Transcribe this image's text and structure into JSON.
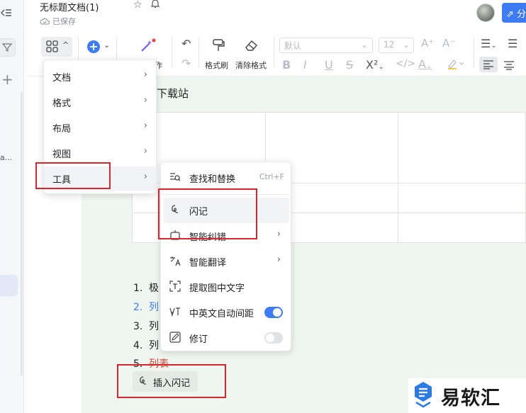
{
  "window": {
    "doc_title": "无标题文档(1)",
    "save_status": "已保存"
  },
  "header": {
    "share_label": "分"
  },
  "toolbar": {
    "format_painter": "格式刷",
    "clear_format": "清除格式",
    "font_name": "默认",
    "font_size": "12",
    "ai_partial_label": "作"
  },
  "menu_main": {
    "items": [
      {
        "label": "文档"
      },
      {
        "label": "格式"
      },
      {
        "label": "布局"
      },
      {
        "label": "视图"
      },
      {
        "label": "工具"
      }
    ]
  },
  "menu_tools": {
    "items": [
      {
        "label": "查找和替换",
        "hint": "Ctrl+F"
      },
      {
        "label": "闪记"
      },
      {
        "label": "智能纠错"
      },
      {
        "label": "智能翻译"
      },
      {
        "label": "提取图中文字"
      },
      {
        "label": "中英文自动间距",
        "toggle": true
      },
      {
        "label": "修订",
        "toggle": false
      }
    ]
  },
  "document": {
    "heading_partial": "下载站",
    "list": [
      {
        "num": "1.",
        "text": "极",
        "color": "#222222"
      },
      {
        "num": "2.",
        "text": "列",
        "color": "#3e7cf6"
      },
      {
        "num": "3.",
        "text": "列",
        "color": "#222222"
      },
      {
        "num": "4.",
        "text": "列",
        "color": "#222222"
      },
      {
        "num": "5.",
        "text": "列表",
        "color": "#e0463a"
      }
    ],
    "insert_button": "插入闪记"
  },
  "sidebar": {
    "truncated": "a..."
  },
  "watermark": {
    "text": "易软汇"
  },
  "colors": {
    "accent": "#3e7cf6",
    "annotation": "#d9262a",
    "page_bg": "#eef6ef"
  }
}
